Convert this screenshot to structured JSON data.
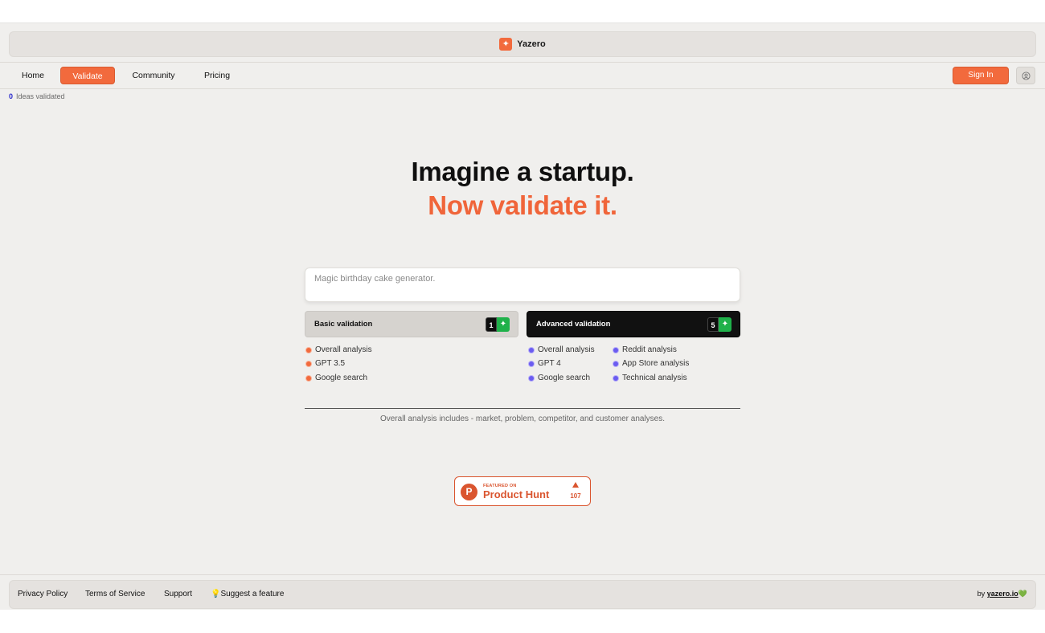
{
  "brand": {
    "name": "Yazero",
    "logo_icon": "spark-icon",
    "accent": "#f26a3d"
  },
  "nav": {
    "items": [
      {
        "label": "Home",
        "active": false
      },
      {
        "label": "Validate",
        "active": true
      },
      {
        "label": "Community",
        "active": false
      },
      {
        "label": "Pricing",
        "active": false
      }
    ],
    "signin_label": "Sign In",
    "user_icon": "user-circle-icon"
  },
  "counter": {
    "value": "0",
    "label": "Ideas validated"
  },
  "hero": {
    "line1": "Imagine a startup.",
    "line2": "Now validate it."
  },
  "idea_input": {
    "placeholder": "Magic birthday cake generator.",
    "value": ""
  },
  "validation": {
    "basic": {
      "label": "Basic validation",
      "credits": "1",
      "features": [
        "Overall analysis",
        "GPT 3.5",
        "Google search"
      ]
    },
    "advanced": {
      "label": "Advanced validation",
      "credits": "5",
      "features_col1": [
        "Overall analysis",
        "GPT 4",
        "Google search"
      ],
      "features_col2": [
        "Reddit analysis",
        "App Store analysis",
        "Technical analysis"
      ]
    }
  },
  "note": "Overall analysis includes - market, problem, competitor, and customer analyses.",
  "product_hunt": {
    "small": "FEATURED ON",
    "title": "Product Hunt",
    "letter": "P",
    "votes": "107"
  },
  "footer": {
    "links": [
      "Privacy Policy",
      "Terms of Service",
      "Support",
      "💡Suggest a feature"
    ],
    "by_label": "by",
    "by_link": "yazero.io",
    "heart": "💚"
  }
}
